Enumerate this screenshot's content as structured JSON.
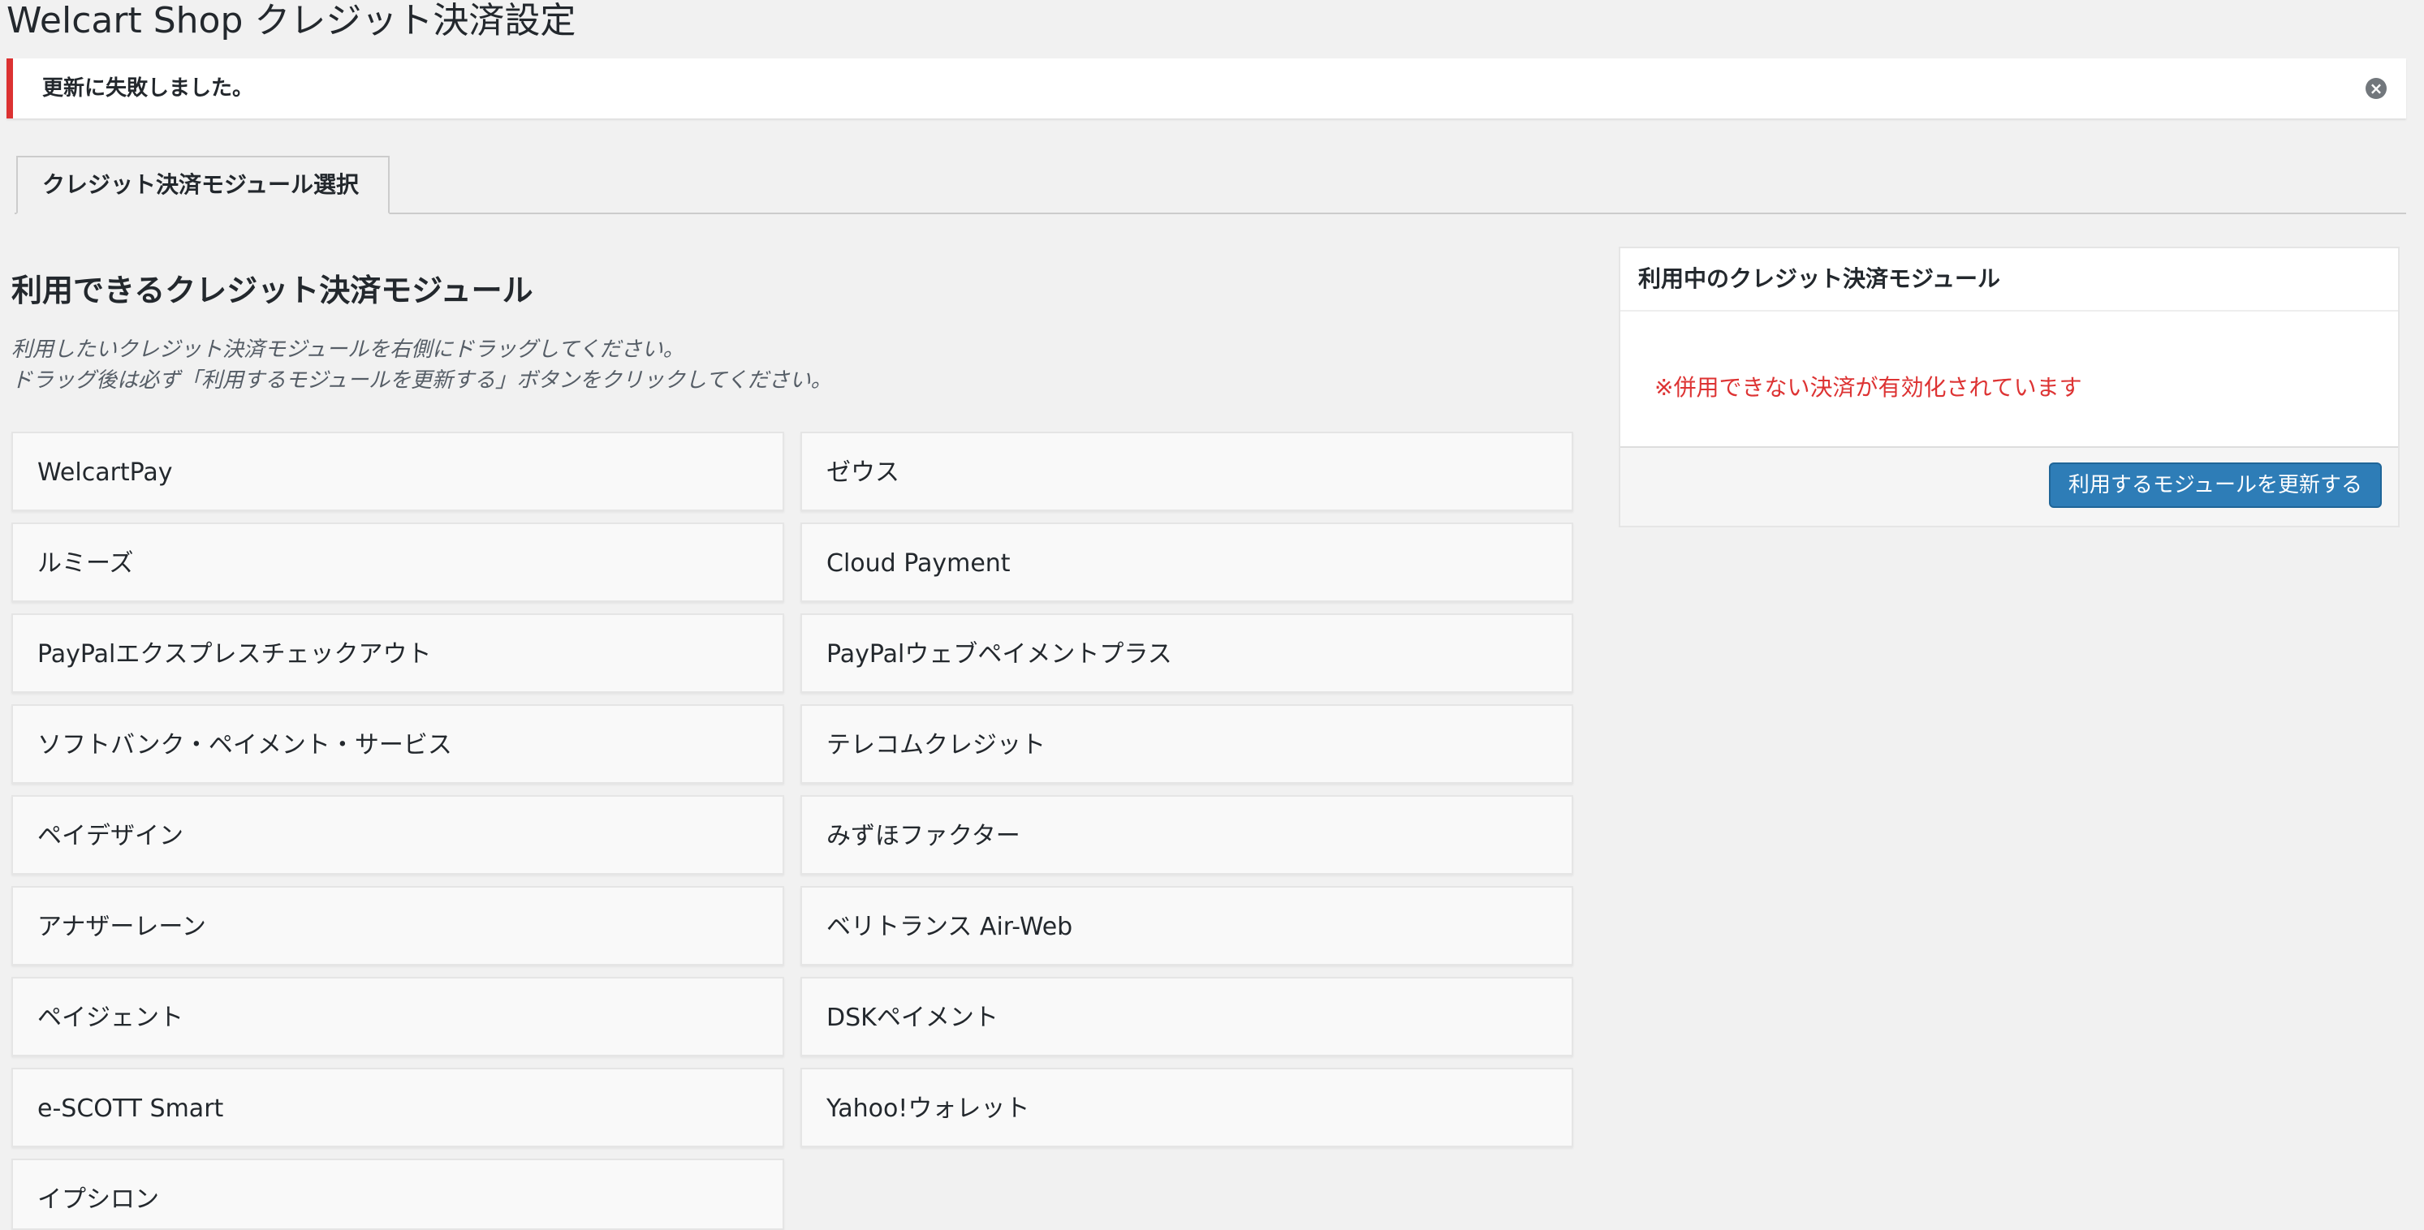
{
  "page": {
    "title": "Welcart Shop クレジット決済設定"
  },
  "notice": {
    "message": "更新に失敗しました。",
    "dismiss_icon": "close-circle-icon",
    "accent_color": "#dc3232"
  },
  "tabs": [
    {
      "label": "クレジット決済モジュール選択",
      "active": true
    }
  ],
  "available": {
    "heading": "利用できるクレジット決済モジュール",
    "description_line1": "利用したいクレジット決済モジュールを右側にドラッグしてください。",
    "description_line2": "ドラッグ後は必ず「利用するモジュールを更新する」ボタンをクリックしてください。",
    "modules": [
      "WelcartPay",
      "ゼウス",
      "ルミーズ",
      "Cloud Payment",
      "PayPalエクスプレスチェックアウト",
      "PayPalウェブペイメントプラス",
      "ソフトバンク・ペイメント・サービス",
      "テレコムクレジット",
      "ペイデザイン",
      "みずほファクター",
      "アナザーレーン",
      "ベリトランス Air-Web",
      "ペイジェント",
      "DSKペイメント",
      "e-SCOTT Smart",
      "Yahoo!ウォレット",
      "イプシロン"
    ]
  },
  "in_use": {
    "title": "利用中のクレジット決済モジュール",
    "warning": "※併用できない決済が有効化されています",
    "warning_color": "#dd3333",
    "update_button": "利用するモジュールを更新する",
    "button_color": "#2e7db7"
  }
}
